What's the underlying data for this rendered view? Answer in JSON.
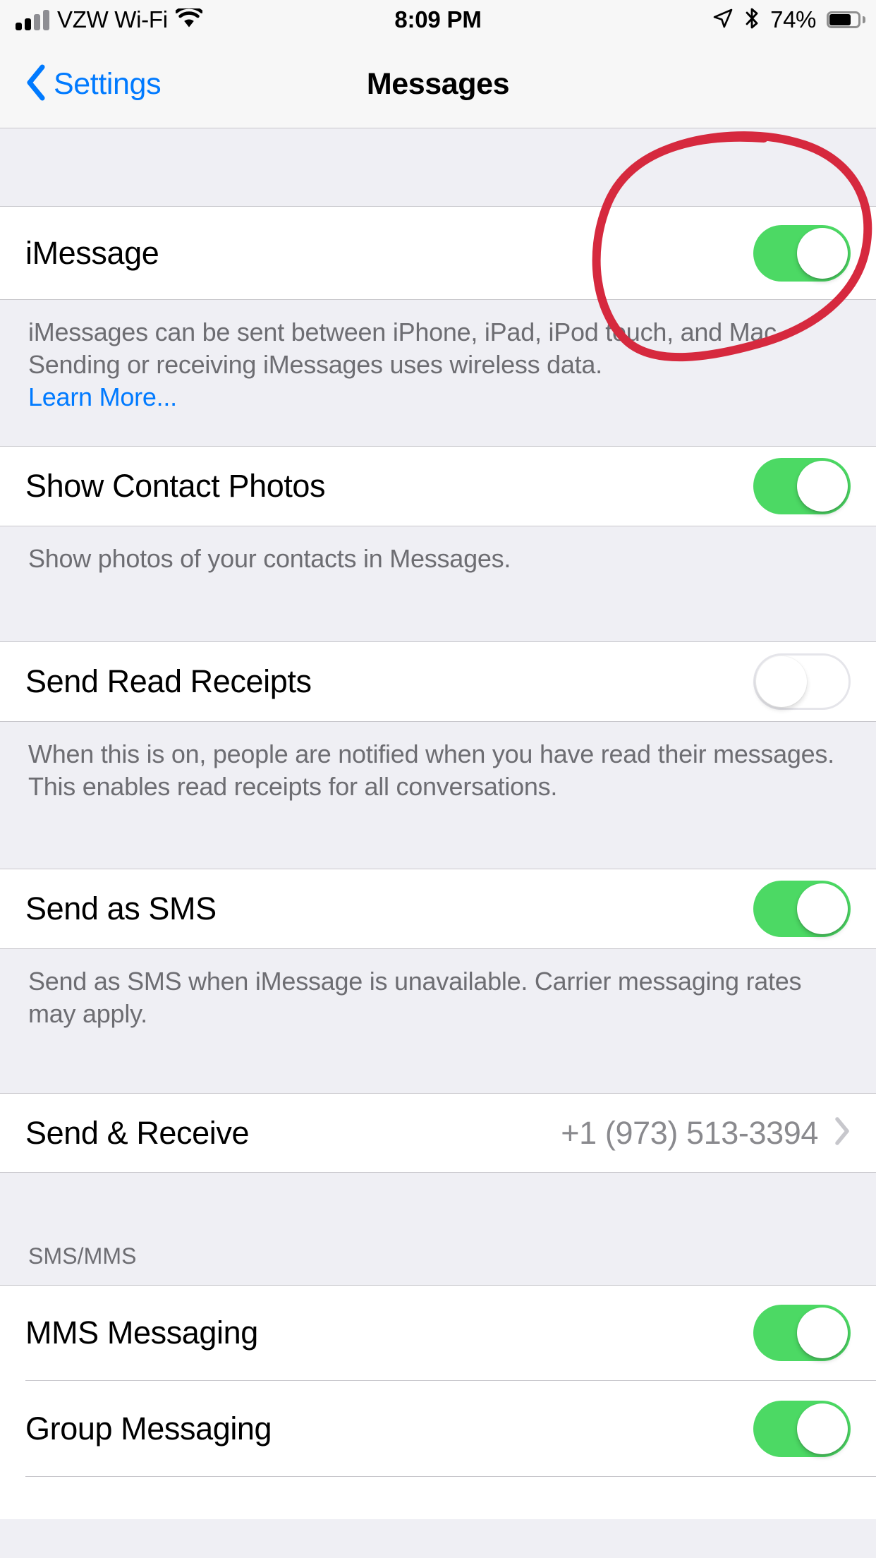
{
  "status_bar": {
    "signal_bars_filled": 2,
    "signal_bars_total": 4,
    "carrier": "VZW Wi-Fi",
    "wifi_icon": "wifi-icon",
    "time": "8:09 PM",
    "location_icon": "location-arrow-icon",
    "bluetooth_icon": "bluetooth-icon",
    "battery_percent": "74%",
    "battery_level": 74
  },
  "nav_bar": {
    "back_label": "Settings",
    "back_icon": "chevron-left-icon",
    "title": "Messages"
  },
  "sections": [
    {
      "rows": [
        {
          "label": "iMessage",
          "control": "switch",
          "value": "on"
        }
      ],
      "footer": "iMessages can be sent between iPhone, iPad, iPod touch, and Mac. Sending or receiving iMessages uses wireless data.",
      "footer_link": "Learn More..."
    },
    {
      "rows": [
        {
          "label": "Show Contact Photos",
          "control": "switch",
          "value": "on"
        }
      ],
      "footer": "Show photos of your contacts in Messages."
    },
    {
      "rows": [
        {
          "label": "Send Read Receipts",
          "control": "switch",
          "value": "off"
        }
      ],
      "footer": "When this is on, people are notified when you have read their messages. This enables read receipts for all conversations."
    },
    {
      "rows": [
        {
          "label": "Send as SMS",
          "control": "switch",
          "value": "on"
        }
      ],
      "footer": "Send as SMS when iMessage is unavailable. Carrier messaging rates may apply."
    },
    {
      "rows": [
        {
          "label": "Send & Receive",
          "control": "disclosure",
          "value": "+1 (973) 513-3394"
        }
      ]
    },
    {
      "header": "SMS/MMS",
      "rows": [
        {
          "label": "MMS Messaging",
          "control": "switch",
          "value": "on"
        },
        {
          "label": "Group Messaging",
          "control": "switch",
          "value": "on"
        }
      ]
    }
  ],
  "annotation": {
    "type": "hand-drawn-ellipse",
    "color": "#D6293E",
    "target": "iMessage toggle"
  },
  "colors": {
    "accent_blue": "#007AFF",
    "switch_on_green": "#4CD964",
    "group_background": "#EFEFF4",
    "row_background": "#FFFFFF",
    "separator": "#C8C7CC",
    "secondary_text": "#6D6D72",
    "annotation_red": "#D6293E"
  }
}
